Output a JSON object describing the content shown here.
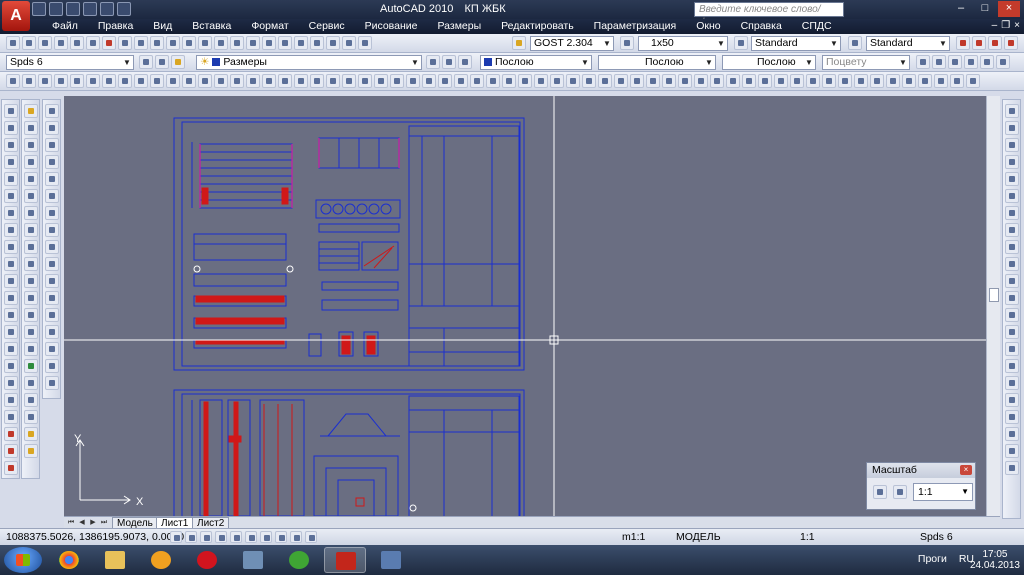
{
  "title": {
    "app": "AutoCAD 2010",
    "doc": "КП ЖБК"
  },
  "search": {
    "placeholder": "Введите ключевое слово/фразу"
  },
  "menu": [
    "Файл",
    "Правка",
    "Вид",
    "Вставка",
    "Формат",
    "Сервис",
    "Рисование",
    "Размеры",
    "Редактировать",
    "Параметризация",
    "Окно",
    "Справка",
    "СПДС"
  ],
  "toolbar": {
    "text_style": "GOST 2.304",
    "dim_style": "1x50",
    "table_style": "Standard",
    "mleader_style": "Standard",
    "workspace": "Spds 6",
    "layer": "Размеры",
    "color": "Послою",
    "linetype": "Послою",
    "lineweight": "Послою",
    "plotstyle": "Поцвету"
  },
  "drawing": {
    "ucs_x": "X",
    "ucs_y": "Y",
    "accent_bg": "#6a6e82",
    "line_color": "#1a2fd0",
    "mark_color": "#d01818",
    "highlight_color": "#c81aa8"
  },
  "layout_tabs": [
    "Модель",
    "Лист1",
    "Лист2"
  ],
  "status": {
    "coords": "1088375.5026, 1386195.9073, 0.0000",
    "scale_small": "m1:1",
    "mode": "МОДЕЛЬ",
    "anno_scale": "1:1",
    "workspace": "Spds 6"
  },
  "scale_palette": {
    "title": "Масштаб",
    "value": "1:1"
  },
  "taskbar": {
    "tray_label": "Проги",
    "lang": "RU",
    "time": "17:05",
    "date": "24.04.2013"
  }
}
